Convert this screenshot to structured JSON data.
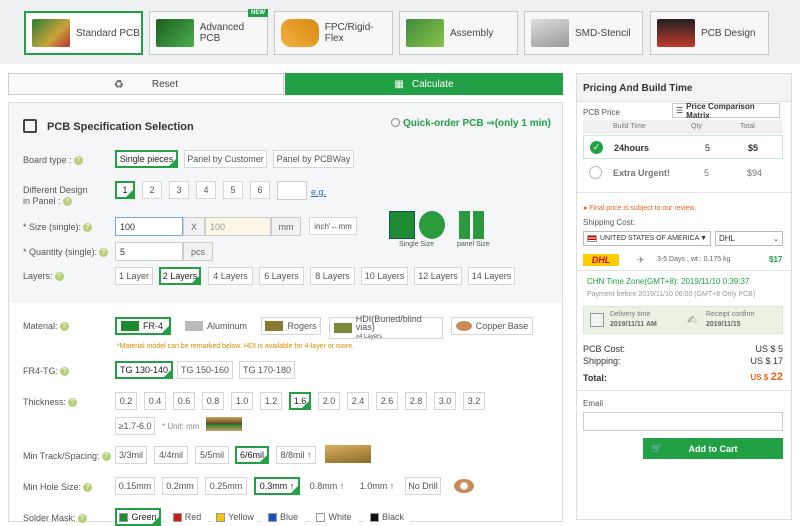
{
  "tabs": [
    {
      "label": "Standard PCB",
      "icon": "standard-pcb-icon"
    },
    {
      "label": "Advanced PCB",
      "icon": "advanced-pcb-icon",
      "badge": "NEW"
    },
    {
      "label": "FPC/Rigid-Flex",
      "icon": "fpc-icon"
    },
    {
      "label": "Assembly",
      "icon": "assembly-icon"
    },
    {
      "label": "SMD-Stencil",
      "icon": "stencil-icon"
    },
    {
      "label": "PCB Design",
      "icon": "pcb-design-icon"
    }
  ],
  "actions": {
    "reset": "Reset",
    "calculate": "Calculate"
  },
  "spec": {
    "title": "PCB Specification Selection",
    "quick_order": "Quick-order PCB ⇒(only 1 min)",
    "board_type": {
      "label": "Board type :",
      "options": [
        "Single pieces",
        "Panel by Customer",
        "Panel by PCBWay"
      ],
      "selected": "Single pieces"
    },
    "design": {
      "label1": "Different Design",
      "label2": "in Panel :",
      "options": [
        "1",
        "2",
        "3",
        "4",
        "5",
        "6"
      ],
      "selected": "1",
      "eg": "e.g."
    },
    "size": {
      "label": "* Size (single):",
      "x_value": "100",
      "x_sep": "X",
      "y_placeholder": "100",
      "unit": "mm",
      "convert": "inch'↔mm",
      "img_single": "Single Size",
      "img_panel": "panel Size"
    },
    "qty": {
      "label": "* Quantity (single):",
      "value": "5",
      "unit": "pcs"
    },
    "layers": {
      "label": "Layers:",
      "options": [
        "1 Layer",
        "2 Layers",
        "4 Layers",
        "6 Layers",
        "8 Layers",
        "10 Layers",
        "12 Layers",
        "14 Layers"
      ],
      "selected": "2 Layers"
    },
    "material": {
      "label": "Material:",
      "options": [
        "FR-4",
        "Aluminum",
        "Rogers",
        "HDI(Buried/blind vias)",
        "Copper Base"
      ],
      "selected": "FR-4",
      "hdi_sub": "≥4 Layers",
      "note": "*Material model can be remarked below. HDI is available for 4-layer or more."
    },
    "tg": {
      "label": "FR4-TG:",
      "options": [
        "TG 130-140",
        "TG 150-160",
        "TG 170-180"
      ],
      "selected": "TG 130-140"
    },
    "thickness": {
      "label": "Thickness:",
      "options": [
        "0.2",
        "0.4",
        "0.6",
        "0.8",
        "1.0",
        "1.2",
        "1.6",
        "2.0",
        "2.4",
        "2.6",
        "2.8",
        "3.0",
        "3.2"
      ],
      "extra": "≥1.7-6.0",
      "unit": "* Unit: mm",
      "selected": "1.6"
    },
    "track": {
      "label": "Min Track/Spacing:",
      "options": [
        "3/3mil",
        "4/4mil",
        "5/5mil",
        "6/6mil",
        "8/8mil ↑"
      ],
      "selected": "6/6mil"
    },
    "hole": {
      "label": "Min Hole Size:",
      "options": [
        "0.15mm",
        "0.2mm",
        "0.25mm",
        "0.3mm ↑",
        "0.8mm ↑",
        "1.0mm ↑",
        "No Drill"
      ],
      "selected": "0.3mm ↑"
    },
    "mask": {
      "label": "Solder Mask:",
      "options": [
        {
          "name": "Green",
          "color": "#1e8a2e"
        },
        {
          "name": "Red",
          "color": "#c81e1e"
        },
        {
          "name": "Yellow",
          "color": "#f1c40f"
        },
        {
          "name": "Blue",
          "color": "#1f4fc4"
        },
        {
          "name": "White",
          "color": "#ffffff"
        },
        {
          "name": "Black",
          "color": "#111111"
        }
      ],
      "selected": "Green"
    }
  },
  "pricing": {
    "title": "Pricing And Build Time",
    "pcb_price_label": "PCB Price",
    "compare": "Price Comparison Matrix",
    "cols": [
      "Build Time",
      "Qty",
      "Total"
    ],
    "rows": [
      {
        "time": "24hours",
        "qty": "5",
        "total": "$5",
        "selected": true
      },
      {
        "time": "Extra Urgent!",
        "qty": "5",
        "total": "$94",
        "selected": false
      }
    ],
    "final_note": "Final price is subject to our review.",
    "ship_label": "Shipping Cost:",
    "country": "UNITED STATES OF AMERICA",
    "carrier": "DHL",
    "carrier_logo": "DHL",
    "ship_days": "3-5 Days , wt : 0.175 kg",
    "ship_price": "$17",
    "tz": "CHN Time Zone(GMT+8): 2019/11/10 0:39:37",
    "pay_before": "Payment before 2019/11/10 06:00 (GMT+8 Only PCB)",
    "delivery_label": "Delivery time",
    "delivery_date": "2019/11/11 AM",
    "receipt_label": "Receipt confirm",
    "receipt_date": "2019/11/15",
    "pcb_cost_label": "PCB Cost:",
    "pcb_cost": "US $ 5",
    "shipping_label": "Shipping:",
    "shipping": "US $ 17",
    "total_label": "Total:",
    "total_prefix": "US $",
    "total": "22",
    "email_label": "Email",
    "cart": "Add to Cart"
  }
}
